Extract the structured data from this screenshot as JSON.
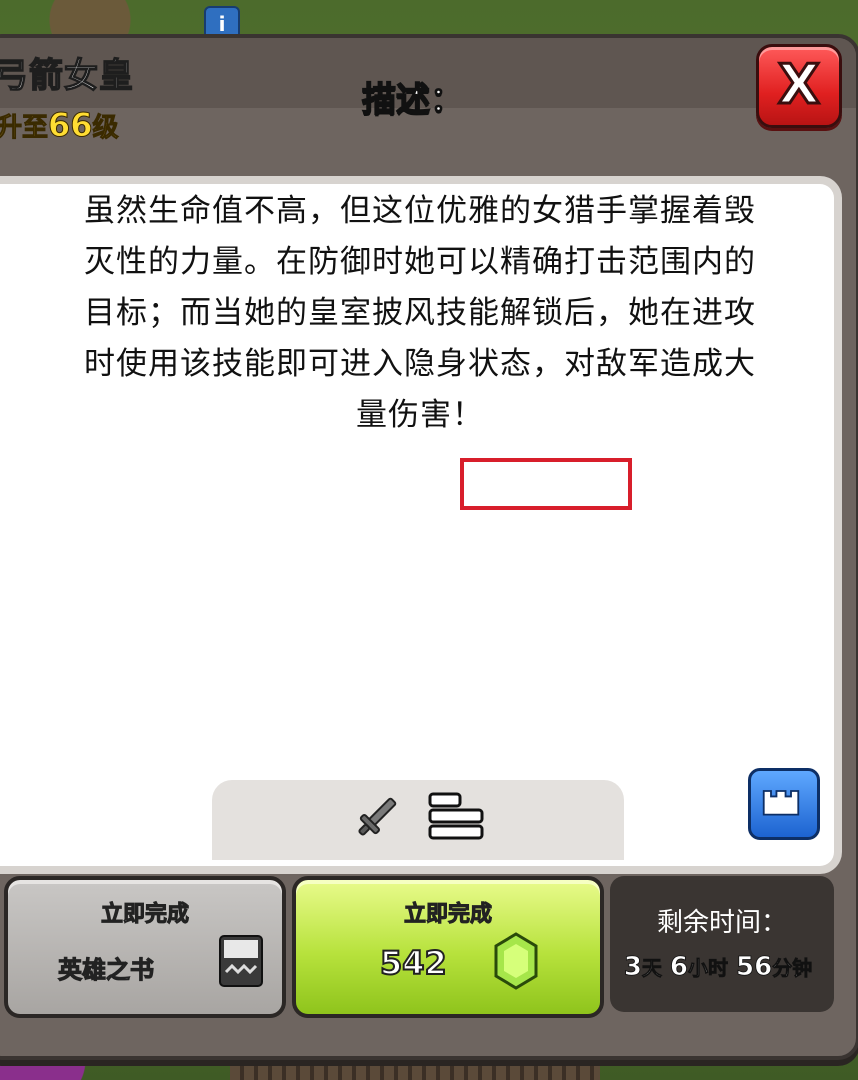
{
  "header": {
    "title": "弓箭女皇",
    "upgrade_prefix": "升至",
    "upgrade_level": "66",
    "upgrade_suffix": "级",
    "close_label": "X"
  },
  "description": {
    "title": "描述：",
    "body": "虽然生命值不高，但这位优雅的女猎手掌握着毁灭性的力量。在防御时她可以精确打击范围内的目标；而当她的皇室披风技能解锁后，她在进攻时使用该技能即可进入隐身状态，对敌军造成大量伤害！",
    "highlighted_term": "皇室披风"
  },
  "buttons": {
    "book": {
      "label": "立即完成",
      "item_name": "英雄之书"
    },
    "gems": {
      "label": "立即完成",
      "cost": "542"
    }
  },
  "timer": {
    "title": "剩余时间：",
    "days": "3",
    "days_unit": "天",
    "hours": "6",
    "hours_unit": "小时",
    "minutes": "56",
    "minutes_unit": "分钟"
  },
  "colors": {
    "gem_button": "#b7e23c",
    "close_button": "#e02020",
    "highlight": "#d81e2b",
    "level_text": "#ffd64a"
  },
  "icons": [
    "info-icon",
    "close-icon",
    "sword-icon",
    "list-icon",
    "castle-icon",
    "book-icon",
    "gem-icon"
  ]
}
